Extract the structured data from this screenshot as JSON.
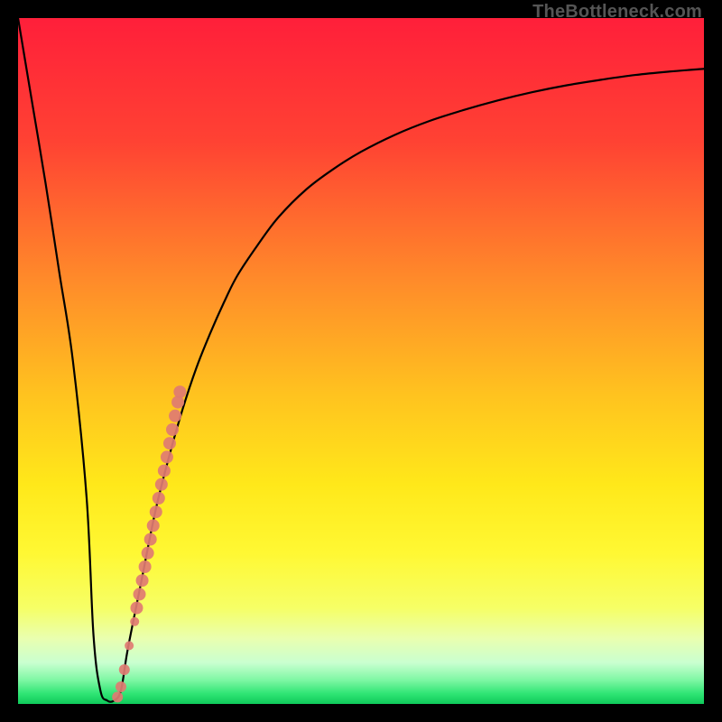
{
  "watermark": "TheBottleneck.com",
  "chart_data": {
    "type": "line",
    "title": "",
    "xlabel": "",
    "ylabel": "",
    "xlim": [
      0,
      100
    ],
    "ylim": [
      0,
      100
    ],
    "grid": false,
    "series": [
      {
        "name": "curve",
        "x": [
          0,
          2,
          4,
          6,
          8,
          10,
          11,
          12,
          13,
          14,
          15,
          16,
          18,
          20,
          22,
          24,
          26,
          28,
          30,
          32,
          35,
          38,
          42,
          46,
          50,
          55,
          60,
          65,
          70,
          75,
          80,
          85,
          90,
          95,
          100
        ],
        "y": [
          100,
          88,
          76,
          63,
          50,
          30,
          10,
          2,
          0.5,
          0.5,
          2,
          8,
          18,
          28,
          36,
          43,
          49,
          54,
          58.5,
          62.5,
          67,
          71,
          75,
          78,
          80.5,
          83,
          85,
          86.6,
          88,
          89.2,
          90.2,
          91,
          91.7,
          92.2,
          92.6
        ]
      }
    ],
    "scatter": {
      "name": "markers",
      "color": "#e07b72",
      "points": [
        {
          "x": 14.5,
          "y": 1.0,
          "r": 6
        },
        {
          "x": 15.0,
          "y": 2.5,
          "r": 6
        },
        {
          "x": 15.5,
          "y": 5.0,
          "r": 6
        },
        {
          "x": 16.2,
          "y": 8.5,
          "r": 5
        },
        {
          "x": 17.0,
          "y": 12.0,
          "r": 5
        },
        {
          "x": 17.3,
          "y": 14.0,
          "r": 7
        },
        {
          "x": 17.7,
          "y": 16.0,
          "r": 7
        },
        {
          "x": 18.1,
          "y": 18.0,
          "r": 7
        },
        {
          "x": 18.5,
          "y": 20.0,
          "r": 7
        },
        {
          "x": 18.9,
          "y": 22.0,
          "r": 7
        },
        {
          "x": 19.3,
          "y": 24.0,
          "r": 7
        },
        {
          "x": 19.7,
          "y": 26.0,
          "r": 7
        },
        {
          "x": 20.1,
          "y": 28.0,
          "r": 7
        },
        {
          "x": 20.5,
          "y": 30.0,
          "r": 7
        },
        {
          "x": 20.9,
          "y": 32.0,
          "r": 7
        },
        {
          "x": 21.3,
          "y": 34.0,
          "r": 7
        },
        {
          "x": 21.7,
          "y": 36.0,
          "r": 7
        },
        {
          "x": 22.1,
          "y": 38.0,
          "r": 7
        },
        {
          "x": 22.5,
          "y": 40.0,
          "r": 7
        },
        {
          "x": 22.9,
          "y": 42.0,
          "r": 7
        },
        {
          "x": 23.3,
          "y": 44.0,
          "r": 7
        },
        {
          "x": 23.6,
          "y": 45.5,
          "r": 7
        }
      ]
    },
    "gradient_stops": [
      {
        "offset": 0.0,
        "color": "#ff1f3a"
      },
      {
        "offset": 0.18,
        "color": "#ff4233"
      },
      {
        "offset": 0.38,
        "color": "#ff8a2a"
      },
      {
        "offset": 0.55,
        "color": "#ffc31f"
      },
      {
        "offset": 0.68,
        "color": "#ffe81a"
      },
      {
        "offset": 0.78,
        "color": "#fff833"
      },
      {
        "offset": 0.86,
        "color": "#f6ff66"
      },
      {
        "offset": 0.905,
        "color": "#e9ffb0"
      },
      {
        "offset": 0.94,
        "color": "#c9ffd0"
      },
      {
        "offset": 0.965,
        "color": "#7ff7a4"
      },
      {
        "offset": 0.985,
        "color": "#2fe574"
      },
      {
        "offset": 1.0,
        "color": "#0fc95a"
      }
    ]
  }
}
